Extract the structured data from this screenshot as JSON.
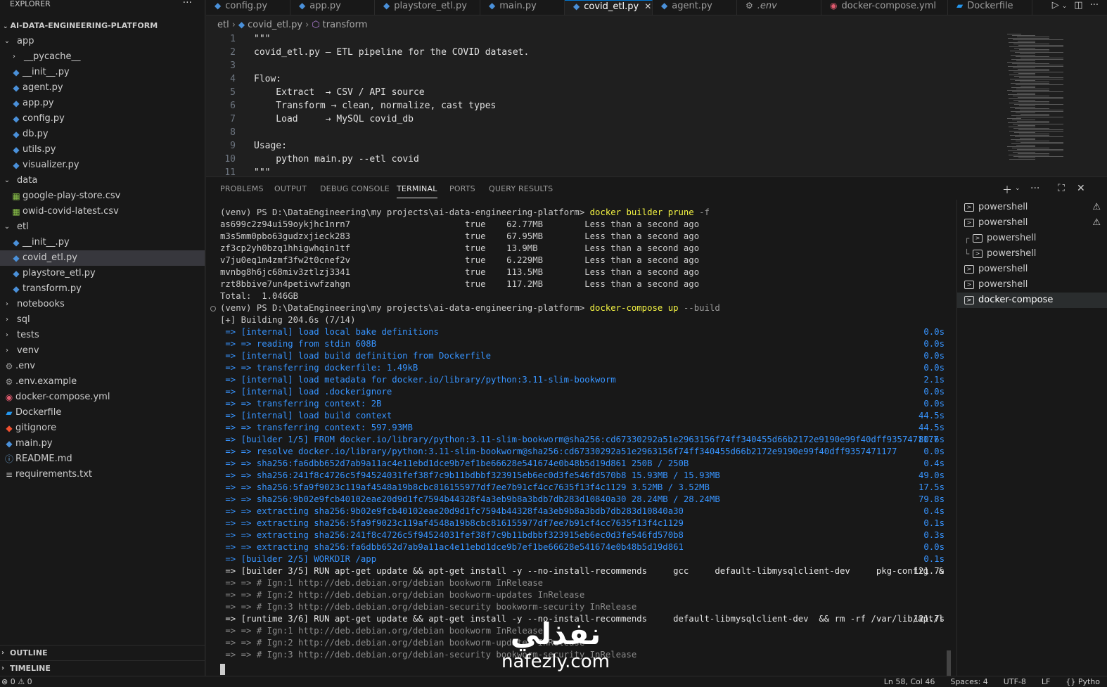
{
  "sidebar": {
    "title": "EXPLORER",
    "more": "···",
    "project": "AI-DATA-ENGINEERING-PLATFORM",
    "items": [
      {
        "label": "app",
        "kind": "folder",
        "open": true,
        "depth": 0
      },
      {
        "label": "__pycache__",
        "kind": "folder",
        "open": false,
        "depth": 1
      },
      {
        "label": "__init__.py",
        "kind": "py",
        "depth": 1
      },
      {
        "label": "agent.py",
        "kind": "py",
        "depth": 1
      },
      {
        "label": "app.py",
        "kind": "py",
        "depth": 1
      },
      {
        "label": "config.py",
        "kind": "py",
        "depth": 1
      },
      {
        "label": "db.py",
        "kind": "py",
        "depth": 1
      },
      {
        "label": "utils.py",
        "kind": "py",
        "depth": 1
      },
      {
        "label": "visualizer.py",
        "kind": "py",
        "depth": 1
      },
      {
        "label": "data",
        "kind": "folder",
        "open": true,
        "depth": 0
      },
      {
        "label": "google-play-store.csv",
        "kind": "csv",
        "depth": 1
      },
      {
        "label": "owid-covid-latest.csv",
        "kind": "csv",
        "depth": 1
      },
      {
        "label": "etl",
        "kind": "folder",
        "open": true,
        "depth": 0
      },
      {
        "label": "__init__.py",
        "kind": "py",
        "depth": 1
      },
      {
        "label": "covid_etl.py",
        "kind": "py",
        "depth": 1,
        "selected": true
      },
      {
        "label": "playstore_etl.py",
        "kind": "py",
        "depth": 1
      },
      {
        "label": "transform.py",
        "kind": "py",
        "depth": 1
      },
      {
        "label": "notebooks",
        "kind": "folder",
        "open": false,
        "depth": 0
      },
      {
        "label": "sql",
        "kind": "folder",
        "open": false,
        "depth": 0
      },
      {
        "label": "tests",
        "kind": "folder",
        "open": false,
        "depth": 0
      },
      {
        "label": "venv",
        "kind": "folder",
        "open": false,
        "depth": 0
      },
      {
        "label": ".env",
        "kind": "gear",
        "depth": 0
      },
      {
        "label": ".env.example",
        "kind": "gear",
        "depth": 0
      },
      {
        "label": "docker-compose.yml",
        "kind": "yml",
        "depth": 0
      },
      {
        "label": "Dockerfile",
        "kind": "whale",
        "depth": 0
      },
      {
        "label": "gitignore",
        "kind": "git",
        "depth": 0
      },
      {
        "label": "main.py",
        "kind": "py",
        "depth": 0
      },
      {
        "label": "README.md",
        "kind": "info",
        "depth": 0
      },
      {
        "label": "requirements.txt",
        "kind": "txt",
        "depth": 0
      }
    ],
    "outline": "OUTLINE",
    "timeline": "TIMELINE"
  },
  "tabs": [
    {
      "label": "config.py",
      "icon": "py"
    },
    {
      "label": "app.py",
      "icon": "py"
    },
    {
      "label": "playstore_etl.py",
      "icon": "py"
    },
    {
      "label": "main.py",
      "icon": "py"
    },
    {
      "label": "covid_etl.py",
      "icon": "py",
      "active": true
    },
    {
      "label": "agent.py",
      "icon": "py"
    },
    {
      "label": ".env",
      "icon": "gear"
    },
    {
      "label": "docker-compose.yml",
      "icon": "yml"
    },
    {
      "label": "Dockerfile",
      "icon": "whale"
    }
  ],
  "breadcrumb": {
    "folder": "etl",
    "file": "covid_etl.py",
    "symbol": "transform"
  },
  "editor": {
    "lines": [
      {
        "n": "1",
        "text": "\"\"\""
      },
      {
        "n": "2",
        "text": "covid_etl.py — ETL pipeline for the COVID dataset."
      },
      {
        "n": "3",
        "text": ""
      },
      {
        "n": "4",
        "text": "Flow:"
      },
      {
        "n": "5",
        "text": "    Extract  → CSV / API source"
      },
      {
        "n": "6",
        "text": "    Transform → clean, normalize, cast types"
      },
      {
        "n": "7",
        "text": "    Load     → MySQL covid_db"
      },
      {
        "n": "8",
        "text": ""
      },
      {
        "n": "9",
        "text": "Usage:"
      },
      {
        "n": "10",
        "text": "    python main.py --etl covid"
      },
      {
        "n": "11",
        "text": "\"\"\""
      }
    ]
  },
  "panel": {
    "tabs": [
      "PROBLEMS",
      "OUTPUT",
      "DEBUG CONSOLE",
      "TERMINAL",
      "PORTS",
      "QUERY RESULTS"
    ],
    "active_tab": "TERMINAL"
  },
  "terminal": {
    "lines": [
      {
        "kind": "prompt",
        "prompt": "(venv) PS D:\\DataEngineering\\my projects\\ai-data-engineering-platform> ",
        "cmd": "docker builder prune",
        "args": " -f"
      },
      {
        "kind": "plain",
        "text": "as699c2z94ui59oykjhc1nrn7                      true    62.77MB        Less than a second ago"
      },
      {
        "kind": "plain",
        "text": "m3s5mm0pbo63gudzxjieck283                      true    67.95MB        Less than a second ago"
      },
      {
        "kind": "plain",
        "text": "zf3cp2yh0bzq1hhigwhqin1tf                      true    13.9MB         Less than a second ago"
      },
      {
        "kind": "plain",
        "text": "v7ju0eq1m4zmf3fw2t0cnef2v                      true    6.229MB        Less than a second ago"
      },
      {
        "kind": "plain",
        "text": "mvnbg8h6jc68miv3ztlzj3341                      true    113.5MB        Less than a second ago"
      },
      {
        "kind": "plain",
        "text": "rzt8bbive7un4petivwfzahgn                      true    117.2MB        Less than a second ago"
      },
      {
        "kind": "plain",
        "text": "Total:  1.046GB"
      },
      {
        "kind": "prompt",
        "dot": true,
        "prompt": "(venv) PS D:\\DataEngineering\\my projects\\ai-data-engineering-platform> ",
        "cmd": "docker-compose up",
        "args": " --build"
      },
      {
        "kind": "plain",
        "text": "[+] Building 204.6s (7/14)"
      },
      {
        "kind": "blue",
        "text": " => [internal] load local bake definitions",
        "t": "0.0s"
      },
      {
        "kind": "blue",
        "text": " => => reading from stdin 608B",
        "t": "0.0s"
      },
      {
        "kind": "blue",
        "text": " => [internal] load build definition from Dockerfile",
        "t": "0.0s"
      },
      {
        "kind": "blue",
        "text": " => => transferring dockerfile: 1.49kB",
        "t": "0.0s"
      },
      {
        "kind": "blue",
        "text": " => [internal] load metadata for docker.io/library/python:3.11-slim-bookworm",
        "t": "2.1s"
      },
      {
        "kind": "blue",
        "text": " => [internal] load .dockerignore",
        "t": "0.0s"
      },
      {
        "kind": "blue",
        "text": " => => transferring context: 2B",
        "t": "0.0s"
      },
      {
        "kind": "blue",
        "text": " => [internal] load build context",
        "t": "44.5s"
      },
      {
        "kind": "blue",
        "text": " => => transferring context: 597.93MB",
        "t": "44.5s"
      },
      {
        "kind": "blue",
        "text": " => [builder 1/5] FROM docker.io/library/python:3.11-slim-bookworm@sha256:cd67330292a51e2963156f74ff340455d66b2172e9190e99f40dff9357471177",
        "t": "80.6s"
      },
      {
        "kind": "blue",
        "text": " => => resolve docker.io/library/python:3.11-slim-bookworm@sha256:cd67330292a51e2963156f74ff340455d66b2172e9190e99f40dff9357471177",
        "t": "0.0s"
      },
      {
        "kind": "blue",
        "text": " => => sha256:fa6dbb652d7ab9a11ac4e11ebd1dce9b7ef1be66628e541674e0b48b5d19d861 250B / 250B",
        "t": "0.4s"
      },
      {
        "kind": "blue",
        "text": " => => sha256:241f8c4726c5f94524031fef38f7c9b11bdbbf323915eb6ec0d3fe546fd570b8 15.93MB / 15.93MB",
        "t": "49.0s"
      },
      {
        "kind": "blue",
        "text": " => => sha256:5fa9f9023c119af4548a19b8cbc816155977df7ee7b91cf4cc7635f13f4c1129 3.52MB / 3.52MB",
        "t": "17.5s"
      },
      {
        "kind": "blue",
        "text": " => => sha256:9b02e9fcb40102eae20d9d1fc7594b44328f4a3eb9b8a3bdb7db283d10840a30 28.24MB / 28.24MB",
        "t": "79.8s"
      },
      {
        "kind": "blue",
        "text": " => => extracting sha256:9b02e9fcb40102eae20d9d1fc7594b44328f4a3eb9b8a3bdb7db283d10840a30",
        "t": "0.4s"
      },
      {
        "kind": "blue",
        "text": " => => extracting sha256:5fa9f9023c119af4548a19b8cbc816155977df7ee7b91cf4cc7635f13f4c1129",
        "t": "0.1s"
      },
      {
        "kind": "blue",
        "text": " => => extracting sha256:241f8c4726c5f94524031fef38f7c9b11bdbbf323915eb6ec0d3fe546fd570b8",
        "t": "0.3s"
      },
      {
        "kind": "blue",
        "text": " => => extracting sha256:fa6dbb652d7ab9a11ac4e11ebd1dce9b7ef1be66628e541674e0b48b5d19d861",
        "t": "0.0s"
      },
      {
        "kind": "blue",
        "text": " => [builder 2/5] WORKDIR /app",
        "t": "0.1s"
      },
      {
        "kind": "white",
        "text": " => [builder 3/5] RUN apt-get update && apt-get install -y --no-install-recommends     gcc     default-libmysqlclient-dev     pkg-config  &",
        "t": "121.7s"
      },
      {
        "kind": "gray",
        "text": " => => # Ign:1 http://deb.debian.org/debian bookworm InRelease"
      },
      {
        "kind": "gray",
        "text": " => => # Ign:2 http://deb.debian.org/debian bookworm-updates InRelease"
      },
      {
        "kind": "gray",
        "text": " => => # Ign:3 http://deb.debian.org/debian-security bookworm-security InRelease"
      },
      {
        "kind": "white",
        "text": " => [runtime 3/6] RUN apt-get update && apt-get install -y --no-install-recommends     default-libmysqlclient-dev  && rm -rf /var/lib/apt/l",
        "t": "121.7s"
      },
      {
        "kind": "gray",
        "text": " => => # Ign:1 http://deb.debian.org/debian bookworm InRelease"
      },
      {
        "kind": "gray",
        "text": " => => # Ign:2 http://deb.debian.org/debian bookworm-updates InRelease"
      },
      {
        "kind": "gray",
        "text": " => => # Ign:3 http://deb.debian.org/debian-security bookworm-security InRelease"
      }
    ]
  },
  "terminal_list": [
    {
      "label": "powershell",
      "warn": true
    },
    {
      "label": "powershell",
      "warn": true
    },
    {
      "label": "powershell",
      "tree": "┌"
    },
    {
      "label": "powershell",
      "tree": "└"
    },
    {
      "label": "powershell"
    },
    {
      "label": "powershell"
    },
    {
      "label": "docker-compose",
      "selected": true
    }
  ],
  "watermark": {
    "arabic": "نفذلي",
    "latin": "nafezly.com"
  },
  "status": {
    "left": "⊗ 0 ⚠ 0",
    "right": [
      "Ln 58, Col 46",
      "Spaces: 4",
      "UTF-8",
      "LF",
      "{} Pytho"
    ]
  }
}
